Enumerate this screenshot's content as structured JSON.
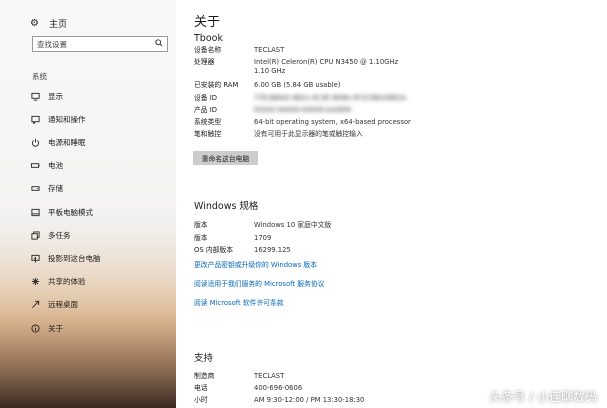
{
  "sidebar": {
    "home_label": "主页",
    "search_placeholder": "查找设置",
    "section_label": "系统",
    "items": [
      {
        "label": "显示",
        "icon": "monitor-icon"
      },
      {
        "label": "通知和操作",
        "icon": "message-icon"
      },
      {
        "label": "电源和睡眠",
        "icon": "power-icon"
      },
      {
        "label": "电池",
        "icon": "battery-icon"
      },
      {
        "label": "存储",
        "icon": "storage-icon"
      },
      {
        "label": "平板电脑模式",
        "icon": "tablet-icon"
      },
      {
        "label": "多任务",
        "icon": "multitask-icon"
      },
      {
        "label": "投影到这台电脑",
        "icon": "projector-icon"
      },
      {
        "label": "共享的体验",
        "icon": "share-icon"
      },
      {
        "label": "远程桌面",
        "icon": "remote-icon"
      },
      {
        "label": "关于",
        "icon": "info-icon",
        "active": true
      }
    ]
  },
  "main": {
    "title": "关于",
    "device_name_heading": "Tbook",
    "specs": [
      {
        "key": "设备名称",
        "value": "TECLAST"
      },
      {
        "key": "处理器",
        "value": "Intel(R) Celeron(R) CPU N3450 @ 1.10GHz   1.10 GHz"
      },
      {
        "key": "已安装的 RAM",
        "value": "6.00 GB (5.84 GB usable)"
      },
      {
        "key": "设备 ID",
        "value": "77E1B8A0-4B31-4C3E-9D8A-3F1C0B1D8E2A"
      },
      {
        "key": "产品 ID",
        "value": "00342-64000-00000-AAOEM"
      },
      {
        "key": "系统类型",
        "value": "64-bit operating system, x64-based processor"
      },
      {
        "key": "笔和触控",
        "value": "没有可用于此显示器的笔或触控输入"
      }
    ],
    "rename_button": "重命名这台电脑",
    "windows_heading": "Windows 规格",
    "windows_specs": [
      {
        "key": "版本",
        "value": "Windows 10 家庭中文版"
      },
      {
        "key": "版本",
        "value": "1709"
      },
      {
        "key": "OS 内部版本",
        "value": "16299.125"
      }
    ],
    "links": [
      "更改产品密钥或升级你的 Windows 版本",
      "阅读适用于我们服务的 Microsoft 服务协议",
      "阅读 Microsoft 软件许可条款"
    ],
    "support_heading": "支持",
    "support_specs": [
      {
        "key": "制造商",
        "value": "TECLAST"
      },
      {
        "key": "电话",
        "value": "400-696-0606"
      },
      {
        "key": "小时",
        "value": "AM 9:30-12:00 / PM 13:30-18:30"
      }
    ]
  },
  "watermark": "头条号 / 小连聊数码"
}
